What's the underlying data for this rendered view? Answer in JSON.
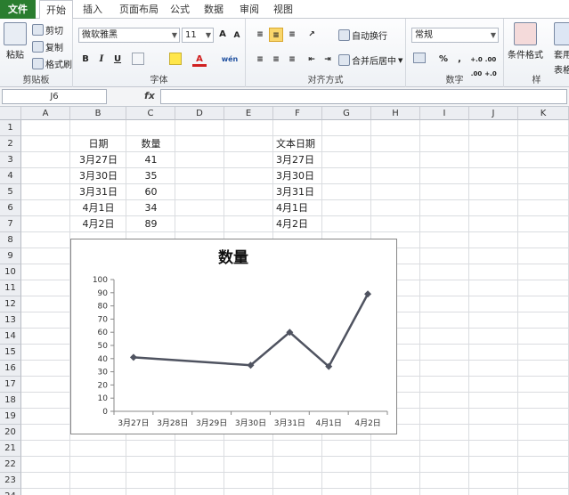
{
  "tabs": [
    "文件",
    "开始",
    "插入",
    "页面布局",
    "公式",
    "数据",
    "审阅",
    "视图"
  ],
  "ribbon": {
    "clipboard": {
      "paste": "粘贴",
      "cut": "剪切",
      "copy": "复制",
      "format_painter": "格式刷",
      "label": "剪贴板"
    },
    "font": {
      "name": "微软雅黑",
      "size": "11",
      "bold": "B",
      "italic": "I",
      "underline": "U",
      "grow": "A",
      "shrink": "A",
      "label": "字体",
      "font_color_letter": "A",
      "phonetic": "wén"
    },
    "alignment": {
      "wrap": "自动换行",
      "merge": "合并后居中",
      "label": "对齐方式"
    },
    "number": {
      "format": "常规",
      "percent": "%",
      "comma": ",",
      "inc_dec": "+.0 .00",
      "dec_dec": ".00 +.0",
      "label": "数字"
    },
    "styles": {
      "conditional": "条件格式",
      "table": "套用",
      "table2": "表格格",
      "label": "样"
    }
  },
  "formula_bar": {
    "name_box": "J6",
    "fx": "fx"
  },
  "columns": [
    "A",
    "B",
    "C",
    "D",
    "E",
    "F",
    "G",
    "H",
    "I",
    "J",
    "K"
  ],
  "rows": [
    "1",
    "2",
    "3",
    "4",
    "5",
    "6",
    "7",
    "8",
    "9",
    "10",
    "11",
    "12",
    "13",
    "14",
    "15",
    "16",
    "17",
    "18",
    "19",
    "20",
    "21",
    "22",
    "23",
    "24"
  ],
  "cells": {
    "b2": "日期",
    "c2": "数量",
    "f2": "文本日期",
    "b3": "3月27日",
    "c3": "41",
    "f3": "3月27日",
    "b4": "3月30日",
    "c4": "35",
    "f4": "3月30日",
    "b5": "3月31日",
    "c5": "60",
    "f5": "3月31日",
    "b6": "4月1日",
    "c6": "34",
    "f6": "4月1日",
    "b7": "4月2日",
    "c7": "89",
    "f7": "4月2日"
  },
  "chart_data": {
    "type": "line",
    "title": "数量",
    "categories": [
      "3月27日",
      "3月28日",
      "3月29日",
      "3月30日",
      "3月31日",
      "4月1日",
      "4月2日"
    ],
    "points": [
      {
        "x": "3月27日",
        "y": 41
      },
      {
        "x": "3月30日",
        "y": 35
      },
      {
        "x": "3月31日",
        "y": 60
      },
      {
        "x": "4月1日",
        "y": 34
      },
      {
        "x": "4月2日",
        "y": 89
      }
    ],
    "ylim": [
      0,
      100
    ],
    "yticks": [
      0,
      10,
      20,
      30,
      40,
      50,
      60,
      70,
      80,
      90,
      100
    ],
    "line_color": "#4f5360",
    "legend": "none"
  }
}
